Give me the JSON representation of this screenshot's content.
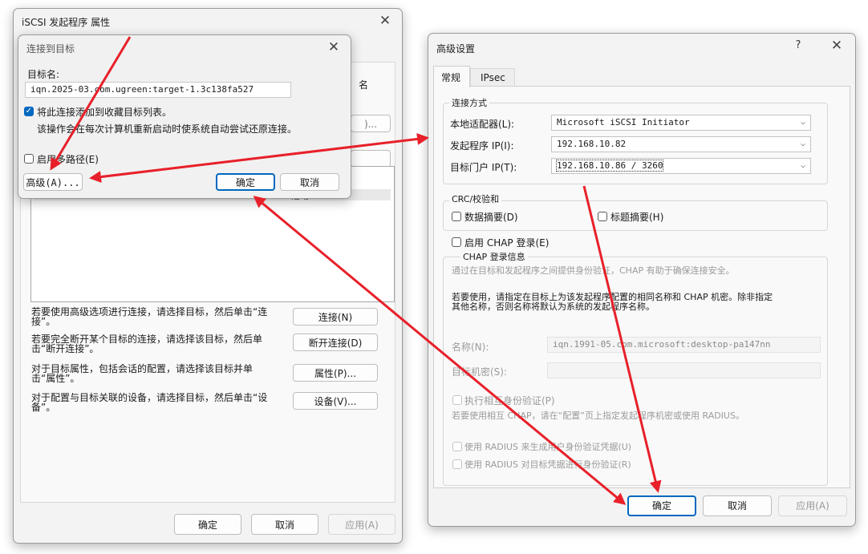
{
  "main_dialog": {
    "title": "iSCSI 发起程序 属性",
    "close": "✕",
    "partial_tab_text": "名",
    "partial_button_text": ")...",
    "list_row_status": "活动",
    "actions": [
      {
        "desc": "若要使用高级选项进行连接，请选择目标，然后单击“连接”。",
        "button": "连接(N)"
      },
      {
        "desc": "若要完全断开某个目标的连接，请选择该目标，然后单击“断开连接”。",
        "button": "断开连接(D)"
      },
      {
        "desc": "对于目标属性，包括会话的配置，请选择该目标并单击“属性”。",
        "button": "属性(P)..."
      },
      {
        "desc": "对于配置与目标关联的设备，请选择目标，然后单击“设备”。",
        "button": "设备(V)..."
      }
    ],
    "footer": {
      "ok": "确定",
      "cancel": "取消",
      "apply": "应用(A)"
    }
  },
  "connect_dialog": {
    "title": "连接到目标",
    "close": "✕",
    "target_name_label": "目标名:",
    "target_name_value": "iqn.2025-03.com.ugreen:target-1.3c138fa527",
    "favorite_checkbox": {
      "label": "将此连接添加到收藏目标列表。",
      "checked": true
    },
    "favorite_note": "该操作会在每次计算机重新启动时使系统自动尝试还原连接。",
    "multipath_checkbox": {
      "label": "启用多路径(E)",
      "checked": false
    },
    "buttons": {
      "advanced": "高级(A)...",
      "ok": "确定",
      "cancel": "取消"
    }
  },
  "advanced_dialog": {
    "title": "高级设置",
    "help": "?",
    "close": "✕",
    "tabs": [
      {
        "label": "常规",
        "active": true
      },
      {
        "label": "IPsec",
        "active": false
      }
    ],
    "connect_by": {
      "group_title": "连接方式",
      "adapter_label": "本地适配器(L):",
      "adapter_value": "Microsoft iSCSI Initiator",
      "initiator_ip_label": "发起程序 IP(I):",
      "initiator_ip_value": "192.168.10.82",
      "portal_ip_label": "目标门户 IP(T):",
      "portal_ip_value": "192.168.10.86 / 3260"
    },
    "crc": {
      "group_title": "CRC/校验和",
      "data_digest": "数据摘要(D)",
      "header_digest": "标题摘要(H)"
    },
    "chap": {
      "enable_label": "启用 CHAP 登录(E)",
      "group_title": "CHAP 登录信息",
      "intro": "通过在目标和发起程序之间提供身份验证，CHAP 有助于确保连接安全。",
      "instructions_line1": "若要使用，请指定在目标上为该发起程序配置的相同名称和 CHAP 机密。除非指定",
      "instructions_line2": "其他名称，否则名称将默认为系统的发起程序名称。",
      "name_label": "名称(N):",
      "name_value": "iqn.1991-05.com.microsoft:desktop-pa147nn",
      "secret_label": "目标机密(S):",
      "mutual_label": "执行相互身份验证(P)",
      "mutual_note": "若要使用相互 CHAP，请在“配置”页上指定发起程序机密或使用 RADIUS。",
      "radius_user": "使用 RADIUS 来生成用户身份验证凭据(U)",
      "radius_target": "使用 RADIUS 对目标凭据进行身份验证(R)"
    },
    "footer": {
      "ok": "确定",
      "cancel": "取消",
      "apply": "应用(A)"
    }
  },
  "annotation_color": "#e8202a"
}
